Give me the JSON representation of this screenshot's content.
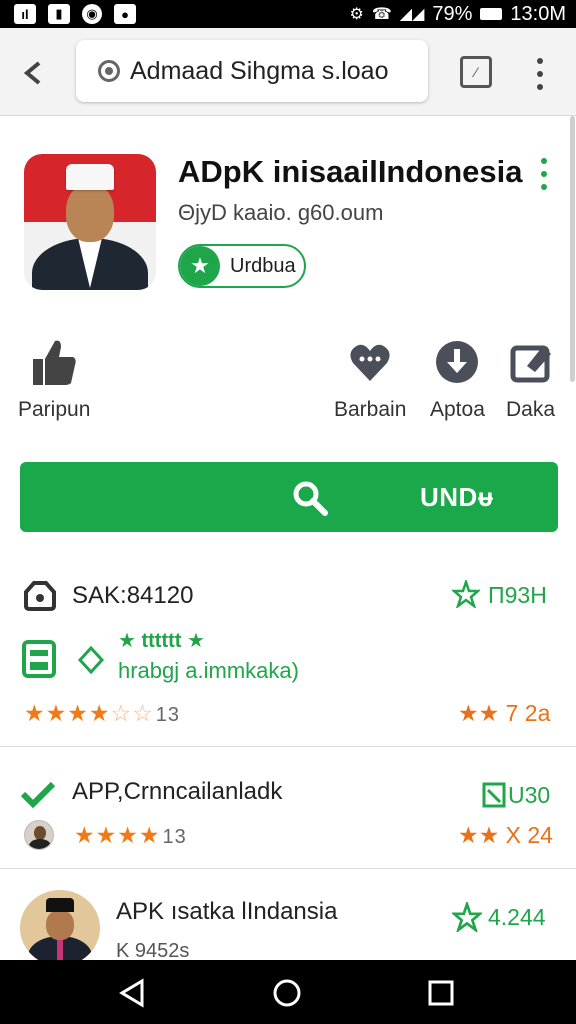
{
  "status_bar": {
    "notification_icons": [
      "chart-icon",
      "document-icon",
      "sync-icon",
      "android-icon"
    ],
    "battery": "79%",
    "time": "13:0M"
  },
  "browser": {
    "url": "Admaad Sihgma s.loao"
  },
  "app": {
    "title": "ADpK inisaailIndonesia",
    "subtitle": "ΘjyD  kaaio. g60.oum",
    "badge_label": "Urdbua"
  },
  "actions": [
    {
      "icon": "thumbs-up-icon",
      "label": "Paripun"
    },
    {
      "icon": "heart-chat-icon",
      "label": "Barbain"
    },
    {
      "icon": "download-icon",
      "label": "Aptoa"
    },
    {
      "icon": "share-icon",
      "label": "Daka"
    }
  ],
  "install_button": {
    "label": "UNDᵾ"
  },
  "list": [
    {
      "title": "SAK:84120",
      "right_text": "Π93H",
      "sub_stars_text": "★ tttttt ★",
      "sub_text": "hrabgj a.immkaka)",
      "rating_count": "13",
      "right_rating": "★★ 7 2a"
    },
    {
      "title": "APP,Crnncailanladk",
      "right_text": "U30",
      "rating_count": "13",
      "right_rating": "★★ X 24"
    },
    {
      "title": "APK ısatka lIndansia",
      "sub_text": "K 9452s",
      "right_text": "4.244"
    }
  ],
  "colors": {
    "accent_green": "#1aa84a",
    "star_orange": "#f07b16",
    "flag_red": "#d6262b"
  }
}
